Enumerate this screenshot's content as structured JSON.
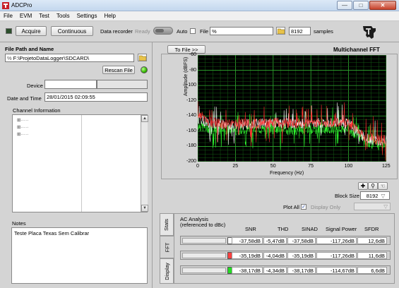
{
  "window": {
    "title": "ADCPro",
    "min": "—",
    "max": "□",
    "close": "✕"
  },
  "menu": [
    "File",
    "EVM",
    "Test",
    "Tools",
    "Settings",
    "Help"
  ],
  "toolbar": {
    "acquire": "Acquire",
    "continuous": "Continuous",
    "data_recorder": "Data recorder",
    "ready": "Ready",
    "auto": "Auto",
    "file_label": "File",
    "file_value": "%",
    "samples_value": "8192",
    "samples_label": "samples"
  },
  "left": {
    "file_path_title": "File Path and Name",
    "file_path_value": "F:\\ProjetoDataLogger\\SDCARD\\",
    "rescan": "Rescan File",
    "device_label": "Device",
    "device_value": "",
    "datetime_label": "Date and Time",
    "datetime_value": "28/01/2015 02:09:55",
    "channel_info_title": "Channel Information",
    "notes_title": "Notes",
    "notes_value": "Teste Placa Texas Sem Calibrar"
  },
  "right": {
    "to_file": "To File >>",
    "chart_title": "Multichannel FFT",
    "block_size_label": "Block Size",
    "block_size_value": "8192",
    "plot_all_label": "Plot All",
    "display_only": "Display Only"
  },
  "chart_data": {
    "type": "line",
    "title": "Multichannel FFT",
    "xlabel": "Frequency (Hz)",
    "ylabel": "Amplitude (dBFS)",
    "xlim": [
      0,
      125
    ],
    "ylim": [
      -200,
      -60
    ],
    "xticks": [
      "0",
      "25",
      "50",
      "75",
      "100",
      "125"
    ],
    "yticks": [
      "-60",
      "-80",
      "-100",
      "-120",
      "-140",
      "-160",
      "-180",
      "-200"
    ],
    "grid": true,
    "series": [
      {
        "color": "#ffffff",
        "x": [
          0,
          5,
          10,
          20,
          30,
          40,
          50,
          60,
          70,
          80,
          90,
          100,
          105,
          110,
          115,
          120,
          125
        ],
        "y": [
          -143,
          -147,
          -151,
          -152,
          -151,
          -150,
          -150,
          -150,
          -150,
          -149,
          -149,
          -150,
          -158,
          -168,
          -171,
          -172,
          -172
        ]
      },
      {
        "color": "#ff3030",
        "x": [
          0,
          5,
          10,
          20,
          30,
          40,
          50,
          60,
          70,
          80,
          90,
          100,
          105,
          110,
          115,
          120,
          125
        ],
        "y": [
          -140,
          -144,
          -149,
          -151,
          -150,
          -150,
          -149,
          -150,
          -149,
          -149,
          -149,
          -150,
          -157,
          -166,
          -170,
          -171,
          -171
        ]
      },
      {
        "color": "#30ff30",
        "x": [
          0,
          5,
          10,
          20,
          30,
          40,
          50,
          60,
          70,
          80,
          90,
          100,
          105,
          110,
          115,
          120,
          125
        ],
        "y": [
          -152,
          -155,
          -157,
          -158,
          -158,
          -157,
          -158,
          -158,
          -157,
          -157,
          -156,
          -158,
          -164,
          -172,
          -176,
          -178,
          -178
        ]
      }
    ]
  },
  "ac": {
    "title1": "AC Analysis",
    "title2": "(referenced to dBc)",
    "tabs": [
      "Stats",
      "FFT",
      "Display"
    ],
    "headers": [
      "SNR",
      "THD",
      "SINAD",
      "Signal Power",
      "SFDR"
    ],
    "rows": [
      {
        "color": "#ffffff",
        "values": [
          "-37,58dB",
          "-5,47dB",
          "-37,58dB",
          "-117,26dB",
          "12,6dB"
        ]
      },
      {
        "color": "#ff4040",
        "values": [
          "-35,19dB",
          "-4,04dB",
          "-35,19dB",
          "-117,26dB",
          "11,6dB"
        ]
      },
      {
        "color": "#22dd22",
        "values": [
          "-38,17dB",
          "-4,34dB",
          "-38,17dB",
          "-114,67dB",
          "6,6dB"
        ]
      }
    ]
  }
}
